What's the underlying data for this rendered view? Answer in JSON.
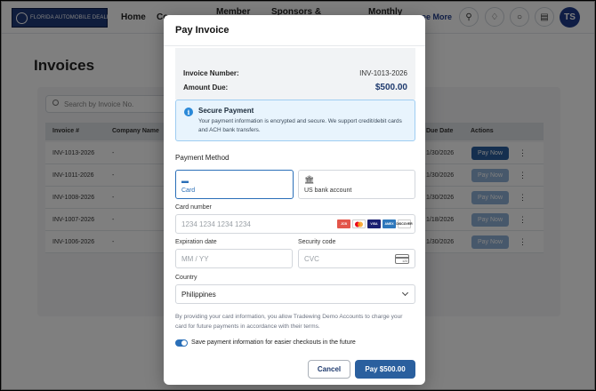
{
  "nav": {
    "logo_text": "FLORIDA AUTOMOBILE DEALERS ASSOCIATION",
    "items": [
      "Home",
      "Co",
      "Member",
      "Sponsors &",
      "Monthly"
    ],
    "see_more": "ee More",
    "avatar_initials": "TS"
  },
  "page": {
    "title": "Invoices",
    "search_placeholder": "Search by Invoice No.",
    "columns": [
      "Invoice #",
      "Company Name",
      "Due Date",
      "Actions"
    ],
    "rows": [
      {
        "invoice": "INV-1013-2026",
        "company": "-",
        "due": "1/30/2026",
        "action": "Pay Now",
        "active": true
      },
      {
        "invoice": "INV-1011-2026",
        "company": "-",
        "due": "1/30/2026",
        "action": "Pay Now",
        "active": false
      },
      {
        "invoice": "INV-1008-2026",
        "company": "-",
        "due": "1/30/2026",
        "action": "Pay Now",
        "active": false
      },
      {
        "invoice": "INV-1007-2026",
        "company": "-",
        "due": "1/18/2026",
        "action": "Pay Now",
        "active": false
      },
      {
        "invoice": "INV-1006-2026",
        "company": "-",
        "due": "1/30/2026",
        "action": "Pay Now",
        "active": false
      }
    ]
  },
  "modal": {
    "title": "Pay Invoice",
    "invoice_number_label": "Invoice Number:",
    "invoice_number": "INV-1013-2026",
    "amount_due_label": "Amount Due:",
    "amount_due": "$500.00",
    "secure_title": "Secure Payment",
    "secure_text": "Your payment information is encrypted and secure. We support credit/debit cards and ACH bank transfers.",
    "payment_method_label": "Payment Method",
    "method_card": "Card",
    "method_bank": "US bank account",
    "card_number_label": "Card number",
    "card_number_placeholder": "1234 1234 1234 1234",
    "expiration_label": "Expiration date",
    "expiration_placeholder": "MM / YY",
    "security_label": "Security code",
    "security_placeholder": "CVC",
    "cvc_icon_text": "123",
    "country_label": "Country",
    "country_value": "Philippines",
    "consent_text": "By providing your card information, you allow Tradewing Demo Accounts to charge your card for future payments in accordance with their terms.",
    "save_label": "Save payment information for easier checkouts in the future",
    "cancel_label": "Cancel",
    "pay_label": "Pay $500.00"
  },
  "card_brands": [
    "JCB",
    "mastercard-icon",
    "VISA",
    "AMEX",
    "DISCOVER"
  ],
  "colors": {
    "primary": "#2a5f9e",
    "accent_blue": "#2a6fb8",
    "info_bg": "#e8f4fd",
    "navy": "#1e3a8a"
  }
}
